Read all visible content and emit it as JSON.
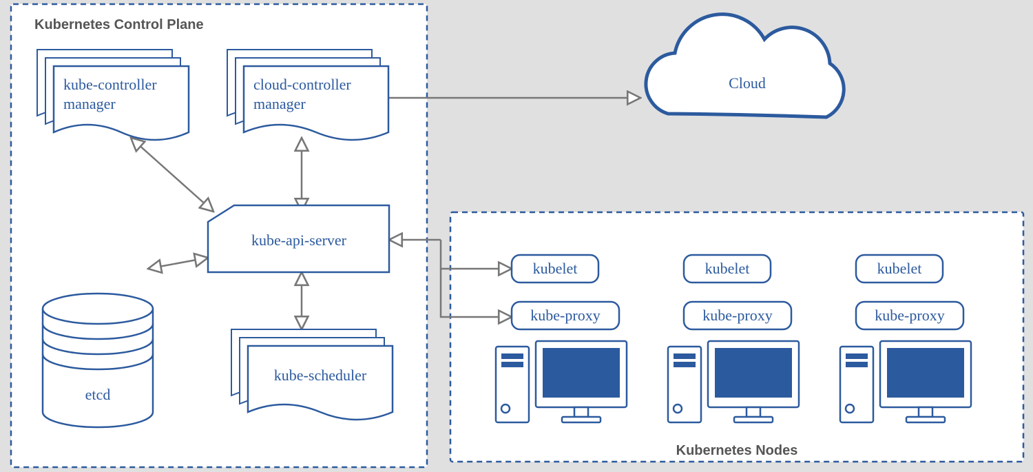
{
  "panels": {
    "control_plane": {
      "title": "Kubernetes Control Plane"
    },
    "nodes": {
      "title": "Kubernetes Nodes"
    }
  },
  "components": {
    "kube_controller_manager": {
      "line1": "kube-controller",
      "line2": "manager"
    },
    "cloud_controller_manager": {
      "line1": "cloud-controller",
      "line2": "manager"
    },
    "kube_api_server": {
      "label": "kube-api-server"
    },
    "kube_scheduler": {
      "label": "kube-scheduler"
    },
    "etcd": {
      "label": "etcd"
    },
    "cloud": {
      "label": "Cloud"
    }
  },
  "node_components": {
    "kubelet": "kubelet",
    "kube_proxy": "kube-proxy"
  },
  "connections": [
    {
      "from": "kube-controller-manager",
      "to": "kube-api-server",
      "bidirectional": true
    },
    {
      "from": "cloud-controller-manager",
      "to": "kube-api-server",
      "bidirectional": true
    },
    {
      "from": "cloud-controller-manager",
      "to": "Cloud",
      "bidirectional": false
    },
    {
      "from": "etcd",
      "to": "kube-api-server",
      "bidirectional": true
    },
    {
      "from": "kube-scheduler",
      "to": "kube-api-server",
      "bidirectional": true
    },
    {
      "from": "kube-api-server",
      "to": "Kubernetes Nodes (kubelet)",
      "bidirectional": true
    },
    {
      "from": "kube-api-server",
      "to": "Kubernetes Nodes (kube-proxy)",
      "bidirectional": false
    }
  ]
}
